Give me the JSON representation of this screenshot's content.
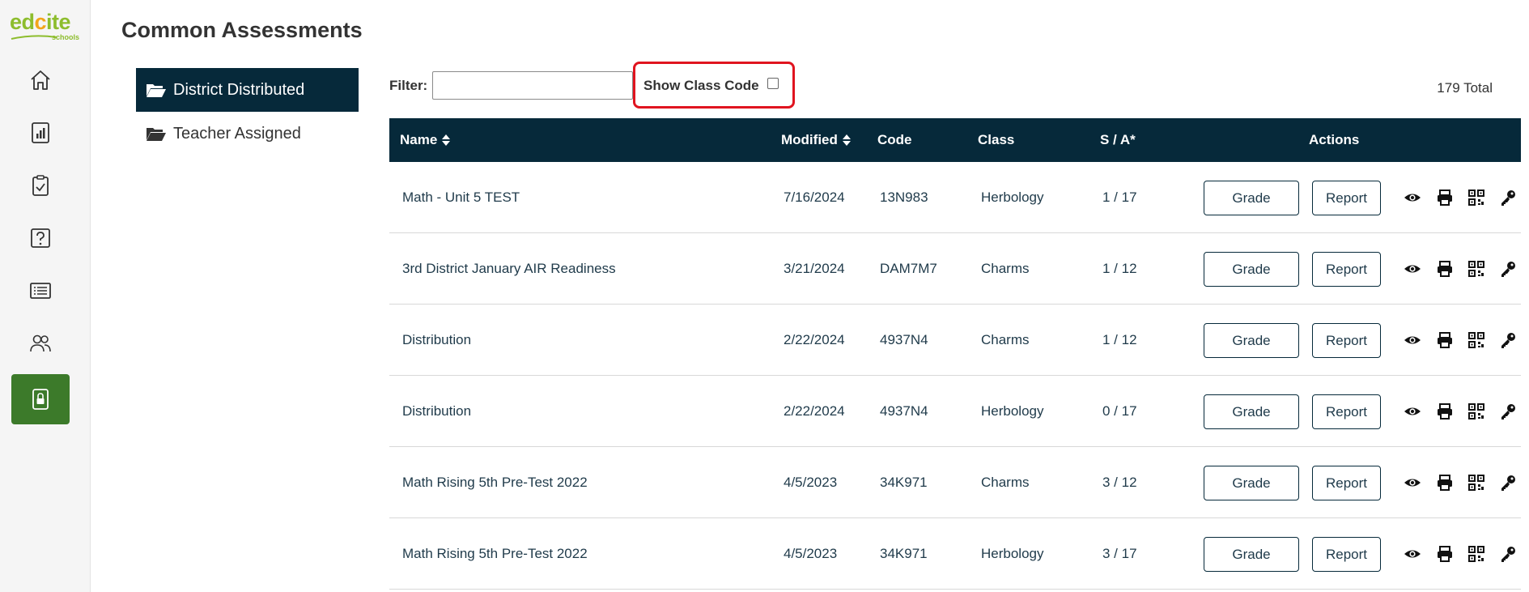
{
  "brand": {
    "logo_word_ed": "ed",
    "logo_word_c": "c",
    "logo_word_ite": "ite",
    "logo_sub": "schools",
    "accent": "#3c7a2a",
    "navy": "#06293a",
    "highlight": "#e0141f"
  },
  "rail": [
    {
      "icon": "home-icon"
    },
    {
      "icon": "reports-icon"
    },
    {
      "icon": "clipboard-icon"
    },
    {
      "icon": "question-icon"
    },
    {
      "icon": "list-icon"
    },
    {
      "icon": "users-icon"
    },
    {
      "icon": "lock-icon",
      "active": true
    }
  ],
  "page": {
    "title": "Common Assessments"
  },
  "folders": [
    {
      "label": "District Distributed",
      "active": true
    },
    {
      "label": "Teacher Assigned",
      "active": false
    }
  ],
  "filter": {
    "label": "Filter:",
    "value": ""
  },
  "class_code": {
    "label": "Show Class Code",
    "checked": false
  },
  "total": "179 Total",
  "table": {
    "headers": {
      "name": "Name",
      "modified": "Modified",
      "code": "Code",
      "class": "Class",
      "sa": "S / A*",
      "actions": "Actions"
    },
    "grade_label": "Grade",
    "report_label": "Report",
    "rows": [
      {
        "name": "Math - Unit 5 TEST",
        "modified": "7/16/2024",
        "code": "13N983",
        "class": "Herbology",
        "sa": "1 / 17"
      },
      {
        "name": "3rd District January AIR Readiness",
        "modified": "3/21/2024",
        "code": "DAM7M7",
        "class": "Charms",
        "sa": "1 / 12"
      },
      {
        "name": "Distribution",
        "modified": "2/22/2024",
        "code": "4937N4",
        "class": "Charms",
        "sa": "1 / 12"
      },
      {
        "name": "Distribution",
        "modified": "2/22/2024",
        "code": "4937N4",
        "class": "Herbology",
        "sa": "0 / 17"
      },
      {
        "name": "Math Rising 5th Pre-Test 2022",
        "modified": "4/5/2023",
        "code": "34K971",
        "class": "Charms",
        "sa": "3 / 12"
      },
      {
        "name": "Math Rising 5th Pre-Test 2022",
        "modified": "4/5/2023",
        "code": "34K971",
        "class": "Herbology",
        "sa": "3 / 17"
      }
    ]
  }
}
